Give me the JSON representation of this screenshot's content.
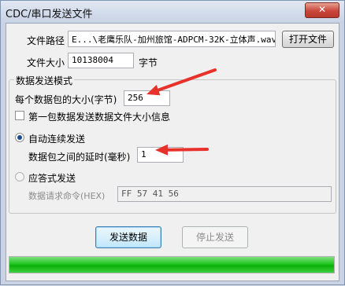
{
  "window": {
    "title": "CDC/串口发送文件",
    "close_glyph": "✕"
  },
  "file": {
    "path_label": "文件路径",
    "path_value": "E...\\老鹰乐队-加州旅馆-ADPCM-32K-立体声.wav",
    "open_button": "打开文件",
    "size_label": "文件大小",
    "size_value": "10138004",
    "size_unit": "字节"
  },
  "mode_group": {
    "title": "数据发送模式",
    "packet_size_label": "每个数据包的大小(字节)",
    "packet_size_value": "256",
    "first_packet_checkbox_label": "第一包数据发送数据文件大小信息",
    "first_packet_checked": false,
    "auto_radio_label": "自动连续发送",
    "auto_selected": true,
    "delay_label": "数据包之间的延时(毫秒)",
    "delay_value": "1",
    "response_radio_label": "应答式发送",
    "response_selected": false,
    "request_cmd_label": "数据请求命令(HEX)",
    "request_cmd_value": "FF 57 41 56"
  },
  "actions": {
    "send_button": "发送数据",
    "stop_button": "停止发送"
  },
  "progress": {
    "fraction": 1.0,
    "color": "#1ec61e"
  },
  "annotation_color": "#e8312a"
}
